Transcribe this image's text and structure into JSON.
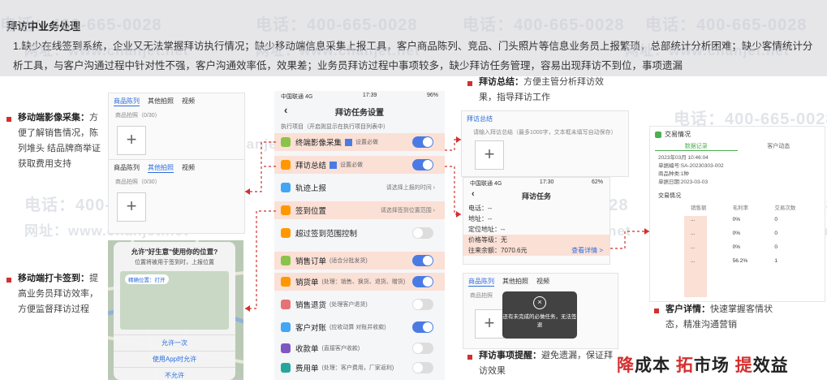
{
  "banner": {
    "title": "拜访中业务处理",
    "text": "1.缺少在线签到系统，企业又无法掌握拜访执行情况；缺少移动端信息采集上报工具，客户商品陈列、竞品、门头照片等信息业务员上报繁琐，总部统计分析困难；缺少客情统计分析工具，与客户沟通过程中针对性不强，客户沟通效率低，效果差；业务员拜访过程中事项较多，缺少拜访任务管理，容易出现拜访不到位，事项遗漏"
  },
  "watermark": {
    "phone": "电话：400-665-0028",
    "site": "网址：www.chanjet.net"
  },
  "annotations": {
    "image_collect_title": "移动端影像采集：",
    "image_collect_text": "方便了解销售情况，陈列堆头 结品牌商举证获取费用支持",
    "checkin_title": "移动端打卡签到：",
    "checkin_text": "提高业务员拜访效率，方便监督拜访过程",
    "summary_title": "拜访总结：",
    "summary_text": "方便主管分析拜访效果，指导拜访工作",
    "customer_title": "客户详情：",
    "customer_text": "快速掌握客情状态，精准沟通营销",
    "reminder_title": "拜访事项提醒：",
    "reminder_text": "避免遗漏，保证拜访效果"
  },
  "photo_card_top": {
    "tabs": [
      "商品陈列",
      "其他拍照",
      "视频"
    ],
    "label": "商品拍照（0/30）"
  },
  "photo_card_mid": {
    "tabs": [
      "商品陈列",
      "其他拍照",
      "视频"
    ],
    "label": "商品拍照（0/30）"
  },
  "location_dialog": {
    "title": "允许\"好生意\"使用你的位置?",
    "subtitle": "位置将被用于签到时，上报位置",
    "precise": "精确位置：打开",
    "allow_once": "允许一次",
    "allow_while": "使用App时允许",
    "deny": "不允许"
  },
  "phone": {
    "carrier": "中国联通 4G",
    "time": "17:39",
    "battery": "96%",
    "title": "拜访任务设置",
    "section": "执行项目（开启则显示在执行项目列表中）",
    "rows": [
      {
        "label": "终端影像采集",
        "sub": "设置必做",
        "on": true
      },
      {
        "label": "拜访总结",
        "sub": "设置必做",
        "on": true
      },
      {
        "label": "轨迹上报",
        "sub": "请选择上报的时间",
        "on": null
      },
      {
        "label": "签到位置",
        "sub": "请选择签到位置范围",
        "on": null
      },
      {
        "label": "超过签到范围控制",
        "sub": "",
        "on": false
      },
      {
        "label": "销售订单",
        "sub": "(适合分批发货)",
        "on": true
      },
      {
        "label": "销货单",
        "sub": "(处理：销售、换货、退货、赠货)",
        "on": true
      },
      {
        "label": "销售退货",
        "sub": "(处理客户退货)",
        "on": false
      },
      {
        "label": "客户对账",
        "sub": "(应收动算 对账并收款)",
        "on": true
      },
      {
        "label": "收款单",
        "sub": "(直接客户收款)",
        "on": false
      },
      {
        "label": "费用单",
        "sub": "(处理：客户费用，厂家返利)",
        "on": false
      }
    ]
  },
  "summary_card": {
    "label": "拜访总结",
    "placeholder": "请输入拜访总结（最多1000字，文本框未填写自动保存）"
  },
  "task_phone": {
    "carrier": "中国联通 4G",
    "time": "17:30",
    "battery": "62%",
    "title": "拜访任务",
    "rows": [
      "电话：--",
      "地址：--",
      "定位地址：--",
      "价格等级：无"
    ],
    "balance_label": "往来余额：7070.6元",
    "detail_link": "查看详情 >"
  },
  "toast_card": {
    "tabs": [
      "商品陈列",
      "其他拍照",
      "视频"
    ],
    "label": "商品拍照",
    "toast": "还有未完成的必做任务，无法签退"
  },
  "detail_card": {
    "title": "交易情况",
    "tabs": [
      "数据记录",
      "客户动态"
    ],
    "date": "2023年03月 10:46:04",
    "order_no": "单据编号:SA-20230303-002",
    "goods": "商品种类:1种",
    "order_date": "单据日期:2023-03-03",
    "section": "交易情况",
    "cols": [
      "销售额",
      "毛利率",
      "交易次数"
    ],
    "rows": [
      [
        "...",
        "0%",
        "0"
      ],
      [
        "...",
        "0%",
        "0"
      ],
      [
        "...",
        "0%",
        "0"
      ],
      [
        "...",
        "56.2%",
        "1"
      ]
    ]
  },
  "slogan": {
    "p1_red": "降",
    "p1": "成本",
    "p2_red": "拓",
    "p2": "市场",
    "p3_red": "提",
    "p3": "效益"
  },
  "colors": {
    "accent_red": "#d32f2f",
    "toggle_blue": "#4a7be5",
    "highlight": "#fbe0d6"
  }
}
